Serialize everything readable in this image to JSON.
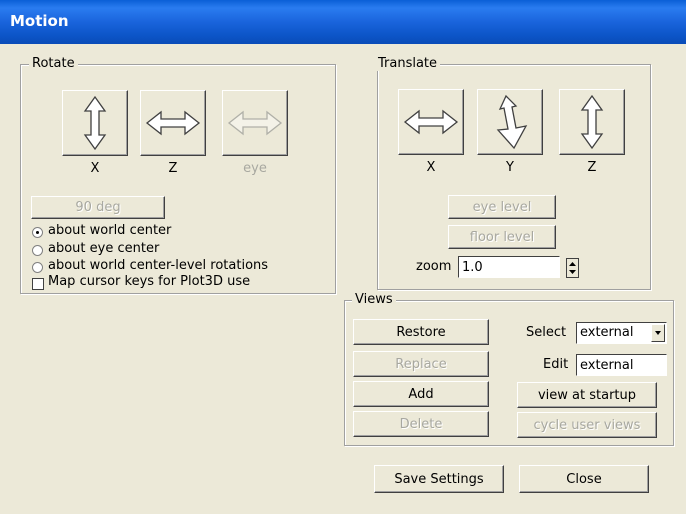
{
  "window": {
    "title": "Motion"
  },
  "rotate": {
    "legend": "Rotate",
    "buttons": [
      {
        "label": "X",
        "icon": "vertical-double-arrow-icon",
        "enabled": true
      },
      {
        "label": "Z",
        "icon": "horizontal-double-arrow-icon",
        "enabled": true
      },
      {
        "label": "eye",
        "icon": "horizontal-double-arrow-icon",
        "enabled": false
      }
    ],
    "deg_button": "90 deg",
    "options": [
      {
        "label": "about world center",
        "selected": true
      },
      {
        "label": "about eye center",
        "selected": false
      },
      {
        "label": "about world center-level rotations",
        "selected": false
      }
    ],
    "checkbox": {
      "label": "Map cursor keys for Plot3D use",
      "checked": false
    }
  },
  "translate": {
    "legend": "Translate",
    "buttons": [
      {
        "label": "X",
        "icon": "horizontal-double-arrow-icon"
      },
      {
        "label": "Y",
        "icon": "diagonal-double-arrow-icon"
      },
      {
        "label": "Z",
        "icon": "vertical-double-arrow-icon"
      }
    ],
    "eye_level": "eye level",
    "floor_level": "floor level",
    "zoom_label": "zoom",
    "zoom_value": "1.0"
  },
  "views": {
    "legend": "Views",
    "restore": "Restore",
    "replace": "Replace",
    "add": "Add",
    "delete": "Delete",
    "select_label": "Select",
    "select_value": "external",
    "edit_label": "Edit",
    "edit_value": "external",
    "view_at_startup": "view at startup",
    "cycle_user_views": "cycle user views"
  },
  "footer": {
    "save_settings": "Save Settings",
    "close": "Close"
  },
  "colors": {
    "titlebar": "#1a64dc",
    "face": "#ece9d8",
    "disabled_text": "#a8a8a0"
  }
}
